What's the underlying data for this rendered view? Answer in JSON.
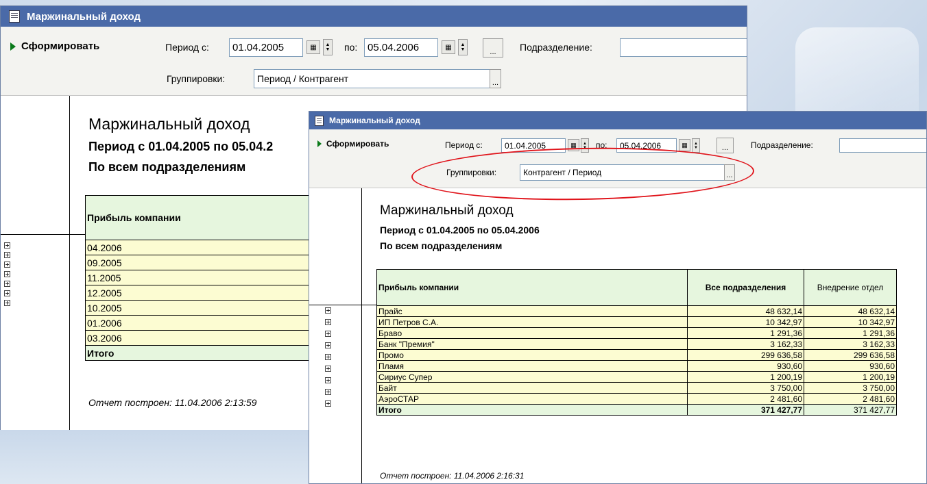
{
  "back": {
    "title": "Маржинальный доход",
    "form_button": "Сформировать",
    "period_from_label": "Период с:",
    "period_from": "01.04.2005",
    "period_to_label": "по:",
    "period_to": "05.04.2006",
    "dots": "...",
    "division_label": "Подразделение:",
    "division_value": "",
    "grouping_label": "Группировки:",
    "grouping_value": "Период / Контрагент",
    "report": {
      "title": "Маржинальный доход",
      "period_line": "Период с 01.04.2005 по 05.04.2",
      "divisions_line": "По всем подразделениям",
      "col_header": "Прибыль компании",
      "rows": [
        "04.2006",
        "09.2005",
        "11.2005",
        "12.2005",
        "10.2005",
        "01.2006",
        "03.2006"
      ],
      "total_label": "Итого",
      "footer": "Отчет построен: 11.04.2006 2:13:59"
    }
  },
  "front": {
    "title": "Маржинальный доход",
    "form_button": "Сформировать",
    "period_from_label": "Период с:",
    "period_from": "01.04.2005",
    "period_to_label": "по:",
    "period_to": "05.04.2006",
    "dots": "...",
    "division_label": "Подразделение:",
    "division_value": "",
    "grouping_label": "Группировки:",
    "grouping_value": "Контрагент / Период",
    "report": {
      "title": "Маржинальный доход",
      "period_line": "Период с 01.04.2005 по 05.04.2006",
      "divisions_line": "По всем подразделениям",
      "headers": [
        "Прибыль компании",
        "Все подразделения",
        "Внедрение отдел"
      ],
      "rows": [
        {
          "name": "Прайс",
          "all": "48 632,14",
          "dept": "48 632,14"
        },
        {
          "name": "ИП Петров С.А.",
          "all": "10 342,97",
          "dept": "10 342,97"
        },
        {
          "name": "Браво",
          "all": "1 291,36",
          "dept": "1 291,36"
        },
        {
          "name": "Банк \"Премия\"",
          "all": "3 162,33",
          "dept": "3 162,33"
        },
        {
          "name": "Промо",
          "all": "299 636,58",
          "dept": "299 636,58"
        },
        {
          "name": "Пламя",
          "all": "930,60",
          "dept": "930,60"
        },
        {
          "name": "Сириус Супер",
          "all": "1 200,19",
          "dept": "1 200,19"
        },
        {
          "name": "Байт",
          "all": "3 750,00",
          "dept": "3 750,00"
        },
        {
          "name": "АэроСТАР",
          "all": "2 481,60",
          "dept": "2 481,60"
        }
      ],
      "total": {
        "label": "Итого",
        "all": "371 427,77",
        "dept": "371 427,77"
      },
      "footer": "Отчет построен: 11.04.2006 2:16:31"
    }
  },
  "colors": {
    "titlebar": "#4a6aa8",
    "header_green": "#e6f6de",
    "row_yellow": "#fcfcd2",
    "highlight": "#e0141b"
  }
}
